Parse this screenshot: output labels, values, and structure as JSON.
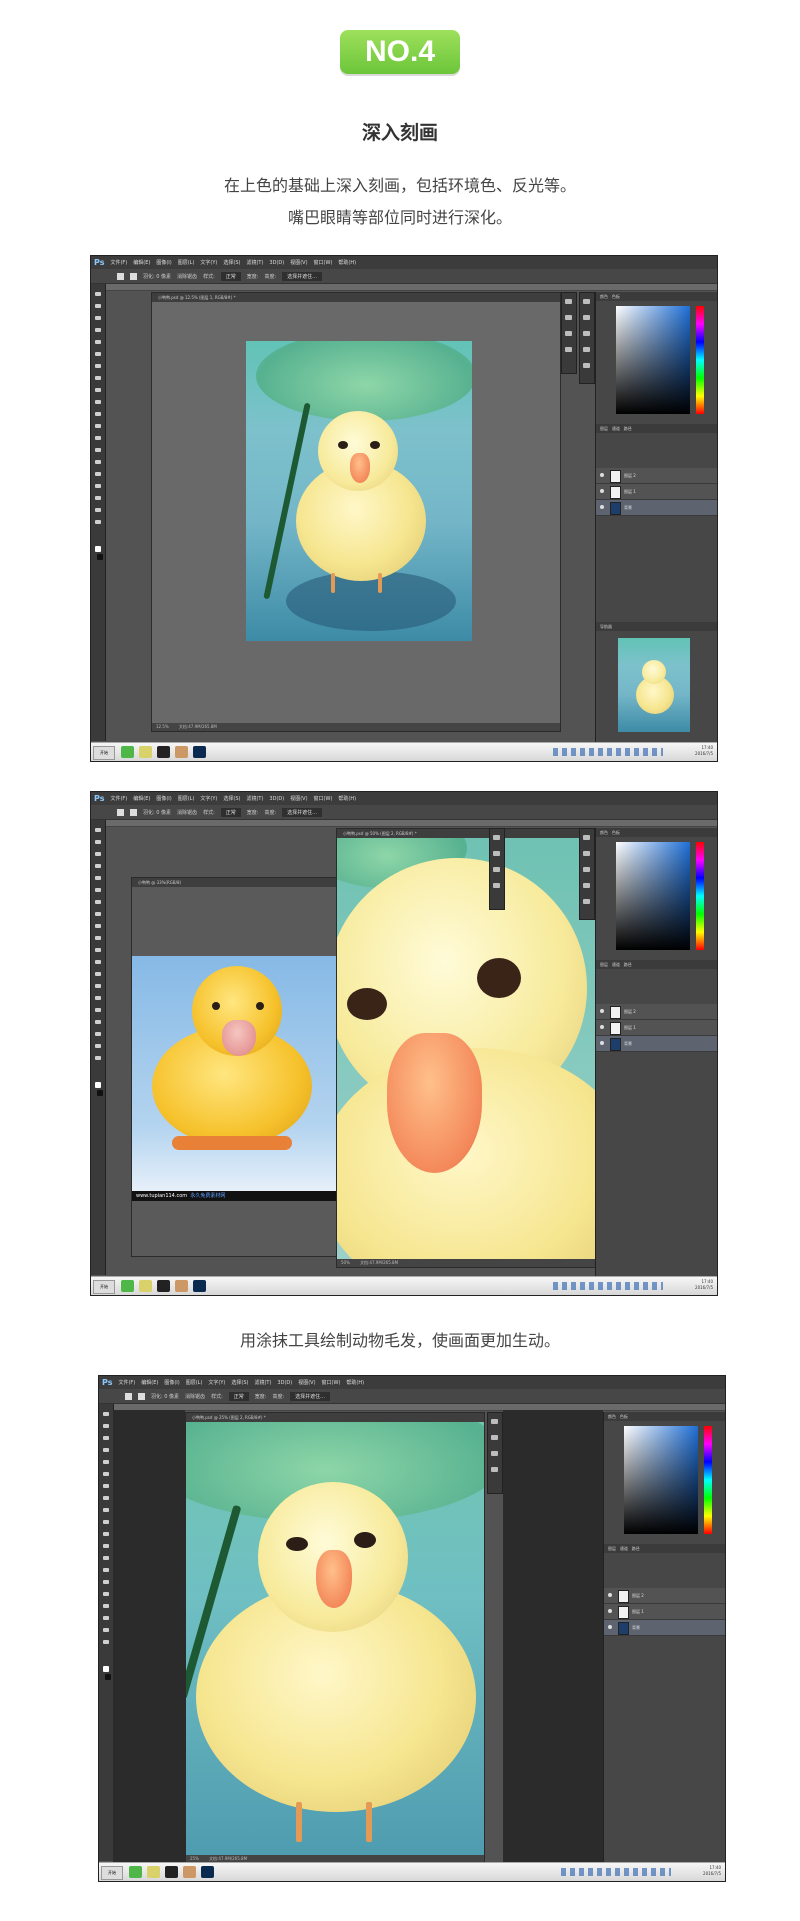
{
  "badge": "NO.4",
  "title": "深入刻画",
  "desc1": "在上色的基础上深入刻画，包括环境色、反光等。",
  "desc2": "嘴巴眼睛等部位同时进行深化。",
  "desc3": "用涂抹工具绘制动物毛发，使画面更加生动。",
  "ps": {
    "menu": [
      "文件(F)",
      "编辑(E)",
      "图像(I)",
      "图层(L)",
      "文字(Y)",
      "选择(S)",
      "滤镜(T)",
      "3D(D)",
      "视图(V)",
      "窗口(W)",
      "帮助(H)"
    ],
    "options": {
      "feather": "羽化: 0 像素",
      "antialias": "消除锯齿",
      "style_label": "样式:",
      "style_value": "正常",
      "width": "宽度:",
      "height": "高度:",
      "refine": "选择并遮住..."
    },
    "panels": {
      "color": "颜色",
      "swatches": "色板",
      "layers": "图层",
      "channels": "通道",
      "paths": "路径",
      "navigator": "导航器",
      "kind": "类型",
      "opacity": "不透明度:",
      "fill": "填充:"
    },
    "layers": [
      "图层 2",
      "图层 1",
      "背景"
    ],
    "taskbar": {
      "start": "开始",
      "time": "17:40",
      "date": "2016/7/5"
    }
  },
  "shot1": {
    "doc_title": "小鸭鸭.psd @ 12.5% (图层 1, RGB/8#) *",
    "zoom": "12.5%",
    "doc_info": "文档:47.9M/265.8M"
  },
  "shot2": {
    "doc_title": "小鸭鸭.psd @ 50% (图层 2, RGB/8#) *",
    "ref_title": "小鸭鸭 @ 33%(RGB/8)",
    "zoom": "50%",
    "doc_info": "文档:47.9M/265.8M",
    "ref_zoom": "33.33%",
    "watermark_url": "www.tupian114.com",
    "watermark_text": "永久免费素材网"
  },
  "shot3": {
    "doc_title": "小鸭鸭.psd @ 25% (图层 2, RGB/8#) *",
    "zoom": "25%",
    "doc_info": "文档:47.9M/265.8M"
  }
}
